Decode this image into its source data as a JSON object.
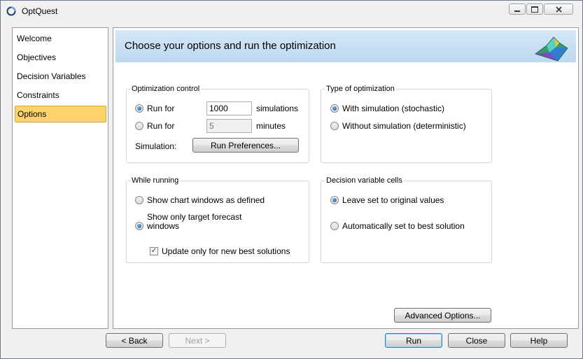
{
  "window": {
    "title": "OptQuest"
  },
  "sidebar": {
    "items": [
      {
        "label": "Welcome"
      },
      {
        "label": "Objectives"
      },
      {
        "label": "Decision Variables"
      },
      {
        "label": "Constraints"
      },
      {
        "label": "Options"
      }
    ],
    "active": "Options"
  },
  "header": {
    "title": "Choose your options and run the optimization"
  },
  "optimization_control": {
    "legend": "Optimization control",
    "run_for_label": "Run for",
    "simulations_value": "1000",
    "simulations_unit": "simulations",
    "minutes_value": "5",
    "minutes_unit": "minutes",
    "selected": "simulations",
    "simulation_label": "Simulation:",
    "run_preferences_button": "Run Preferences..."
  },
  "type_of_optimization": {
    "legend": "Type of optimization",
    "with_simulation": "With simulation (stochastic)",
    "without_simulation": "Without simulation (deterministic)",
    "selected": "with_simulation"
  },
  "while_running": {
    "legend": "While running",
    "show_chart_windows": "Show chart windows as defined",
    "show_target_forecast": "Show only target forecast windows",
    "selected": "show_target_forecast",
    "update_only_label": "Update only for new best solutions",
    "update_only_checked": true
  },
  "decision_variable_cells": {
    "legend": "Decision variable cells",
    "leave_set": "Leave set to original values",
    "auto_set": "Automatically set to best solution",
    "selected": "leave_set"
  },
  "buttons": {
    "advanced_options": "Advanced Options...",
    "back": "< Back",
    "next": "Next >",
    "run": "Run",
    "close": "Close",
    "help": "Help"
  },
  "colors": {
    "header_bg": "#c9e0f4",
    "active_nav": "#fdd46b"
  }
}
